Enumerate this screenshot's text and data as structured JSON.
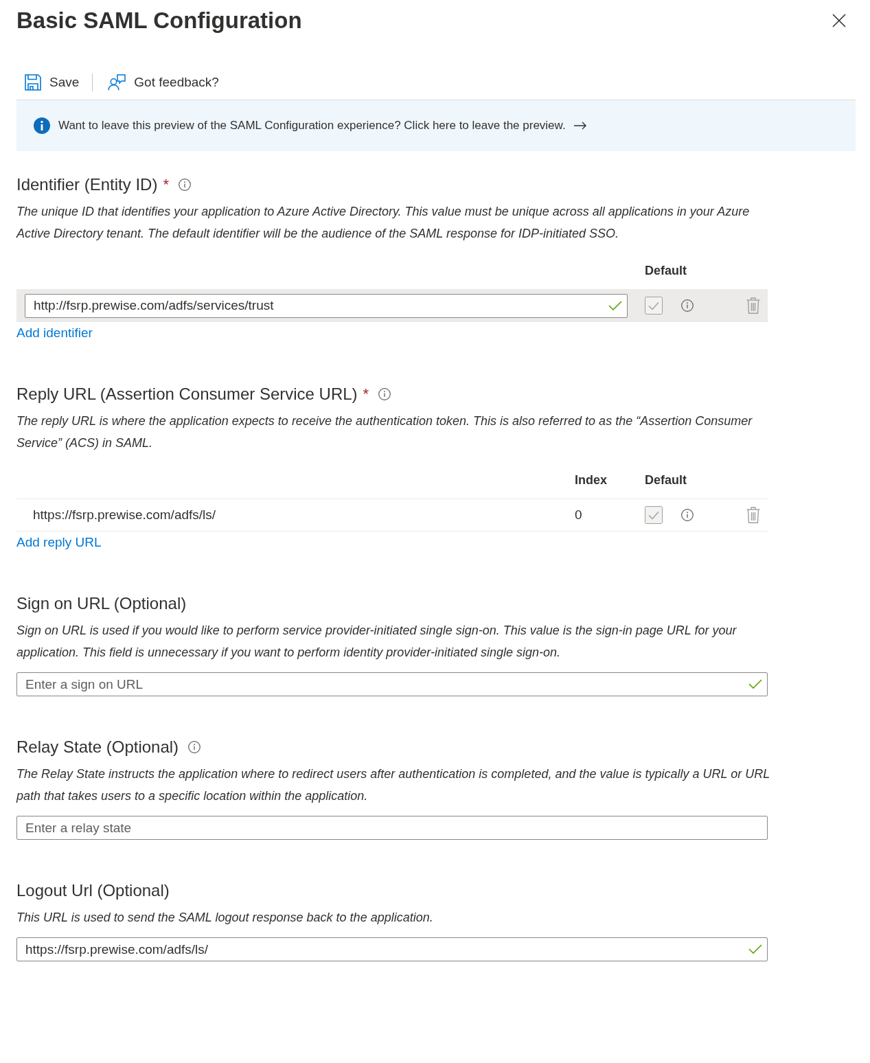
{
  "panel": {
    "title": "Basic SAML Configuration"
  },
  "toolbar": [
    {
      "kind": "save",
      "label": "Save"
    },
    {
      "kind": "feedback",
      "label": "Got feedback?"
    }
  ],
  "banner": {
    "text": "Want to leave this preview of the SAML Configuration experience? Click here to leave the preview."
  },
  "sections": [
    {
      "kind": "identifiers",
      "title": "Identifier (Entity ID)",
      "required_mark": "*",
      "info": true,
      "description": "The unique ID that identifies your application to Azure Active Directory. This value must be unique across all applications in your Azure Active Directory tenant. The default identifier will be the audience of the SAML response for IDP-initiated SSO.",
      "columns": [
        {
          "kind": "default",
          "label": "Default"
        }
      ],
      "rows": [
        {
          "value": "http://fsrp.prewise.com/adfs/services/trust",
          "valid": true,
          "checked": true,
          "disabled": true,
          "selected": true
        }
      ],
      "add_link": "Add identifier"
    },
    {
      "kind": "reply_urls",
      "title": "Reply URL (Assertion Consumer Service URL)",
      "required_mark": "*",
      "info": true,
      "description": "The reply URL is where the application expects to receive the authentication token. This is also referred to as the “Assertion Consumer Service” (ACS) in SAML.",
      "columns": [
        {
          "kind": "index",
          "label": "Index"
        },
        {
          "kind": "default",
          "label": "Default"
        }
      ],
      "rows": [
        {
          "value": "https://fsrp.prewise.com/adfs/ls/",
          "index": "0",
          "checked": true,
          "disabled": true,
          "selected": false
        }
      ],
      "add_link": "Add reply URL"
    },
    {
      "kind": "field",
      "title": "Sign on URL (Optional)",
      "info": false,
      "description": "Sign on URL is used if you would like to perform service provider-initiated single sign-on. This value is the sign-in page URL for your application. This field is unnecessary if you want to perform identity provider-initiated single sign-on.",
      "field": {
        "placeholder": "Enter a sign on URL",
        "valid": true
      }
    },
    {
      "kind": "field",
      "title": "Relay State (Optional)",
      "info": true,
      "description": "The Relay State instructs the application where to redirect users after authentication is completed, and the value is typically a URL or URL path that takes users to a specific location within the application.",
      "field": {
        "placeholder": "Enter a relay state",
        "valid": false
      }
    },
    {
      "kind": "field",
      "title": "Logout Url (Optional)",
      "info": false,
      "description": "This URL is used to send the SAML logout response back to the application.",
      "field": {
        "value": "https://fsrp.prewise.com/adfs/ls/",
        "valid": true
      }
    }
  ]
}
